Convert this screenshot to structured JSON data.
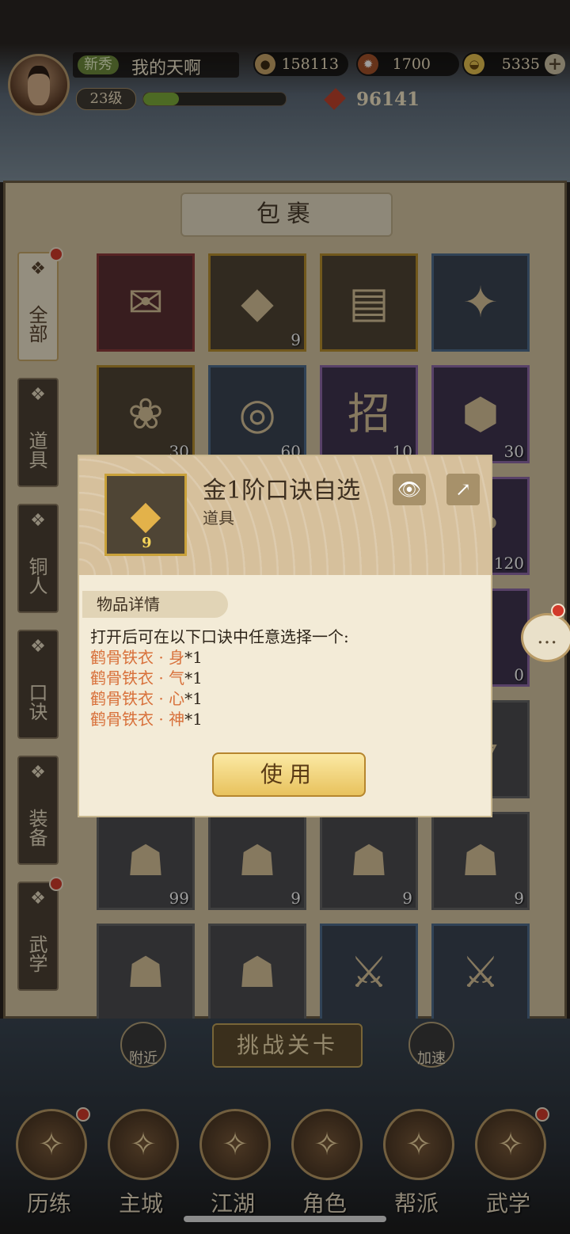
{
  "player": {
    "rank_tag": "新秀",
    "name": "我的天啊",
    "level": "23级",
    "exp_fraction": 0.25,
    "power": "96141"
  },
  "currencies": [
    {
      "icon": "coin-icon",
      "value": "158113"
    },
    {
      "icon": "stamina-icon",
      "value": "1700"
    },
    {
      "icon": "gold-ingot-icon",
      "value": "5335"
    }
  ],
  "panel_title": "包裹",
  "side_tabs": [
    {
      "label": "全部",
      "icon": "fan-icon",
      "active": true,
      "badge": true
    },
    {
      "label": "道具",
      "icon": "bag-icon",
      "active": false,
      "badge": false
    },
    {
      "label": "铜人",
      "icon": "figure-icon",
      "active": false,
      "badge": false
    },
    {
      "label": "口诀",
      "icon": "scroll-icon",
      "active": false,
      "badge": false
    },
    {
      "label": "装备",
      "icon": "armor-icon",
      "active": false,
      "badge": false
    },
    {
      "label": "武学",
      "icon": "book-icon",
      "active": false,
      "badge": true
    }
  ],
  "grid": [
    {
      "glyph": "✉",
      "count": "",
      "quality": "red"
    },
    {
      "glyph": "◆",
      "count": "9",
      "quality": "gold"
    },
    {
      "glyph": "▤",
      "count": "",
      "quality": "gold"
    },
    {
      "glyph": "✦",
      "count": "",
      "quality": "blue"
    },
    {
      "glyph": "❀",
      "count": "30",
      "quality": "gold"
    },
    {
      "glyph": "◎",
      "count": "60",
      "quality": "blue"
    },
    {
      "glyph": "招",
      "count": "10",
      "quality": "purple"
    },
    {
      "glyph": "⬢",
      "count": "30",
      "quality": "purple"
    },
    {
      "glyph": "",
      "count": "",
      "quality": "blue"
    },
    {
      "glyph": "",
      "count": "",
      "quality": "blue"
    },
    {
      "glyph": "",
      "count": "",
      "quality": "purple"
    },
    {
      "glyph": "✿",
      "count": "120",
      "quality": "purple"
    },
    {
      "glyph": "",
      "count": "",
      "quality": "gray"
    },
    {
      "glyph": "",
      "count": "",
      "quality": "gray"
    },
    {
      "glyph": "",
      "count": "",
      "quality": "gray"
    },
    {
      "glyph": "",
      "count": "0",
      "quality": "purple"
    },
    {
      "glyph": "",
      "count": "",
      "quality": "gray"
    },
    {
      "glyph": "",
      "count": "",
      "quality": "gray"
    },
    {
      "glyph": "",
      "count": "",
      "quality": "gray"
    },
    {
      "glyph": "▱",
      "count": "",
      "quality": "gray"
    },
    {
      "glyph": "☗",
      "count": "99",
      "quality": "gray"
    },
    {
      "glyph": "☗",
      "count": "9",
      "quality": "gray"
    },
    {
      "glyph": "☗",
      "count": "9",
      "quality": "gray"
    },
    {
      "glyph": "☗",
      "count": "9",
      "quality": "gray"
    },
    {
      "glyph": "☗",
      "count": "",
      "quality": "gray"
    },
    {
      "glyph": "☗",
      "count": "",
      "quality": "gray"
    },
    {
      "glyph": "⚔",
      "count": "",
      "quality": "blue"
    },
    {
      "glyph": "⚔",
      "count": "",
      "quality": "blue"
    }
  ],
  "modal": {
    "item_name": "金1阶口诀自选",
    "item_type": "道具",
    "item_count": "9",
    "detail_label": "物品详情",
    "description": "打开后可在以下口诀中任意选择一个:",
    "options": [
      {
        "name": "鹤骨铁衣 · 身",
        "qty": "*1"
      },
      {
        "name": "鹤骨铁衣 · 气",
        "qty": "*1"
      },
      {
        "name": "鹤骨铁衣 · 心",
        "qty": "*1"
      },
      {
        "name": "鹤骨铁衣 · 神",
        "qty": "*1"
      }
    ],
    "use_label": "使用"
  },
  "challenge_label": "挑战关卡",
  "side_buttons": {
    "nearby": "附近",
    "speedup": "加速"
  },
  "bottom_nav": [
    {
      "label": "历练",
      "icon": "training-icon",
      "badge": true
    },
    {
      "label": "主城",
      "icon": "city-icon",
      "badge": false
    },
    {
      "label": "江湖",
      "icon": "jianghu-icon",
      "badge": false
    },
    {
      "label": "角色",
      "icon": "character-icon",
      "badge": false
    },
    {
      "label": "帮派",
      "icon": "guild-icon",
      "badge": false
    },
    {
      "label": "武学",
      "icon": "martial-arts-icon",
      "badge": true
    }
  ]
}
